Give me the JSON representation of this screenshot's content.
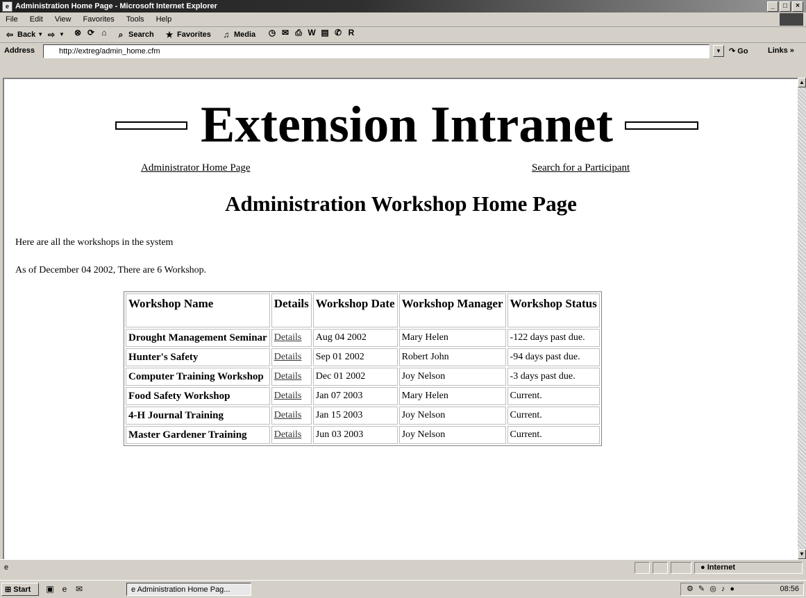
{
  "window": {
    "title": "Administration Home Page - Microsoft Internet Explorer"
  },
  "menubar": {
    "items": [
      "File",
      "Edit",
      "View",
      "Favorites",
      "Tools",
      "Help"
    ]
  },
  "toolbar": {
    "back_label": "Back",
    "search_label": "Search",
    "favorites_label": "Favorites",
    "media_label": "Media"
  },
  "addressbar": {
    "label": "Address",
    "url": "http://extreg/admin_home.cfm",
    "go_label": "Go",
    "links_label": "Links »"
  },
  "page": {
    "logo_text": "Extension Intranet",
    "nav_left": "Administrator Home Page",
    "nav_right": "Search for a Participant",
    "title": "Administration Workshop Home Page",
    "intro": "Here are all the workshops in the system",
    "summary": "As of December 04 2002, There are 6 Workshop.",
    "table": {
      "headers": [
        "Workshop Name",
        "Details",
        "Workshop Date",
        "Workshop Manager",
        "Workshop Status"
      ],
      "rows": [
        {
          "name": "Drought Management Seminar",
          "details": "Details",
          "date": "Aug 04 2002",
          "manager": "Mary Helen",
          "status": "-122 days past due."
        },
        {
          "name": "Hunter's Safety",
          "details": "Details",
          "date": "Sep 01 2002",
          "manager": "Robert John",
          "status": "-94 days past due."
        },
        {
          "name": "Computer Training Workshop",
          "details": "Details",
          "date": "Dec 01 2002",
          "manager": "Joy Nelson",
          "status": "-3 days past due."
        },
        {
          "name": "Food Safety Workshop",
          "details": "Details",
          "date": "Jan 07 2003",
          "manager": "Mary Helen",
          "status": "Current."
        },
        {
          "name": "4-H Journal Training",
          "details": "Details",
          "date": "Jan 15 2003",
          "manager": "Joy Nelson",
          "status": "Current."
        },
        {
          "name": "Master Gardener Training",
          "details": "Details",
          "date": "Jun 03 2003",
          "manager": "Joy Nelson",
          "status": "Current."
        }
      ]
    }
  },
  "statusbar": {
    "zone": "Internet"
  },
  "taskbar": {
    "start_label": "Start",
    "task_label": "Administration Home Pag...",
    "clock": "08:56"
  }
}
